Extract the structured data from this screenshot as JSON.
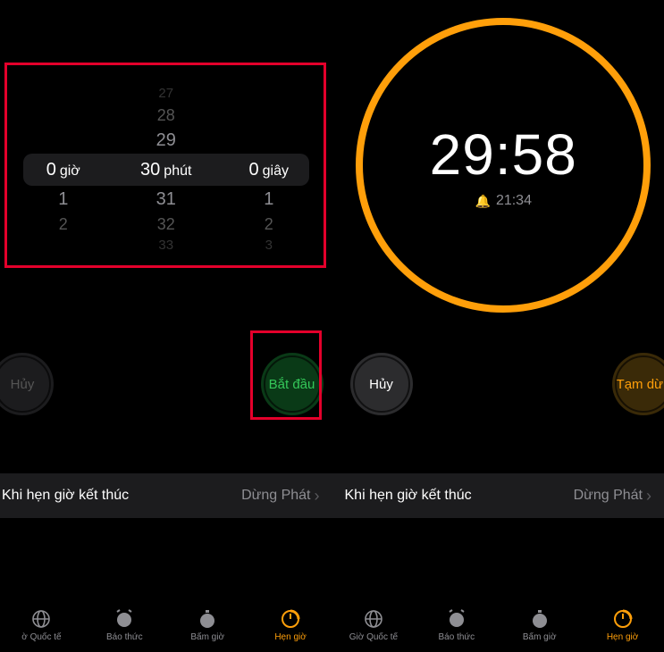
{
  "left": {
    "picker": {
      "hours": {
        "selected": "0",
        "unit": "giờ",
        "below": [
          "1",
          "2"
        ]
      },
      "minutes": {
        "above": [
          "27",
          "28",
          "29"
        ],
        "selected": "30",
        "unit": "phút",
        "below": [
          "31",
          "32",
          "33"
        ]
      },
      "seconds": {
        "selected": "0",
        "unit": "giây",
        "below": [
          "1",
          "2",
          "3"
        ]
      }
    },
    "cancel": "Hủy",
    "start": "Bắt đầu",
    "optionLabel": "Khi hẹn giờ kết thúc",
    "optionValue": "Dừng Phát"
  },
  "right": {
    "countdown": "29:58",
    "endTime": "21:34",
    "cancel": "Hủy",
    "pause": "Tạm dừn",
    "optionLabel": "Khi hẹn giờ kết thúc",
    "optionValue": "Dừng Phát"
  },
  "tabs": {
    "world": "Giờ Quốc tế",
    "worldTrunc": "ờ Quốc tế",
    "alarm": "Báo thức",
    "stopwatch": "Bấm giờ",
    "timer": "Hẹn giờ"
  }
}
